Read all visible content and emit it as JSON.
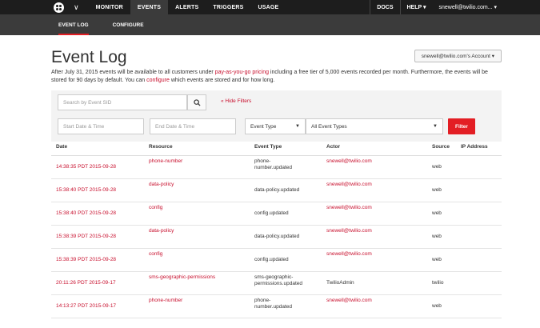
{
  "topnav": {
    "items": [
      "MONITOR",
      "EVENTS",
      "ALERTS",
      "TRIGGERS",
      "USAGE"
    ],
    "active": "EVENTS",
    "right": {
      "docs": "DOCS",
      "help": "HELP ▾",
      "user": "snewell@twilio.com... ▾"
    }
  },
  "subnav": {
    "items": [
      "EVENT LOG",
      "CONFIGURE"
    ],
    "active": "EVENT LOG"
  },
  "page": {
    "title": "Event Log",
    "account_button": "snewell@twilio.com's Account ▾",
    "notice_pre": "After July 31, 2015 events will be available to all customers under ",
    "notice_link1": "pay-as-you-go pricing",
    "notice_mid": " including a free tier of 5,000 events recorded per month. Furthermore, the events will be stored for 90 days by default. You can ",
    "notice_link2": "configure",
    "notice_post": " which events are stored and for how long."
  },
  "filters": {
    "search_placeholder": "Search by Event SID",
    "hide_filters": "« Hide Filters",
    "start_date_placeholder": "Start Date & Time",
    "end_date_placeholder": "End Date & Time",
    "type_select": "Event Type",
    "event_types_select": "All Event Types",
    "filter_button": "Filter"
  },
  "table": {
    "headers": [
      "Date",
      "Resource",
      "Event Type",
      "Actor",
      "Source",
      "IP Address"
    ],
    "rows": [
      {
        "date": "14:38:35 PDT 2015-09-28",
        "resource": "phone-number",
        "event_type": "phone-number.updated",
        "actor": "snewell@twilio.com",
        "source": "web"
      },
      {
        "date": "15:38:40 PDT 2015-09-28",
        "resource": "data-policy",
        "event_type": "data-policy.updated",
        "actor": "snewell@twilio.com",
        "source": "web"
      },
      {
        "date": "15:38:40 PDT 2015-09-28",
        "resource": "config",
        "event_type": "config.updated",
        "actor": "snewell@twilio.com",
        "source": "web"
      },
      {
        "date": "15:38:39 PDT 2015-09-28",
        "resource": "data-policy",
        "event_type": "data-policy.updated",
        "actor": "snewell@twilio.com",
        "source": "web"
      },
      {
        "date": "15:38:39 PDT 2015-09-28",
        "resource": "config",
        "event_type": "config.updated",
        "actor": "snewell@twilio.com",
        "source": "web"
      },
      {
        "date": "20:11:26 PDT 2015-09-17",
        "resource": "sms-geographic-permissions",
        "event_type": "sms-geographic-permissions.updated",
        "actor": "TwilioAdmin",
        "source": "twilio"
      },
      {
        "date": "14:13:27 PDT 2015-09-17",
        "resource": "phone-number",
        "event_type": "phone-number.updated",
        "actor": "snewell@twilio.com",
        "source": "web"
      }
    ]
  },
  "colors": {
    "accent": "#e31e24",
    "link": "#c8102e",
    "topbar": "#1d1d1d",
    "subbar": "#3b3b3b"
  }
}
